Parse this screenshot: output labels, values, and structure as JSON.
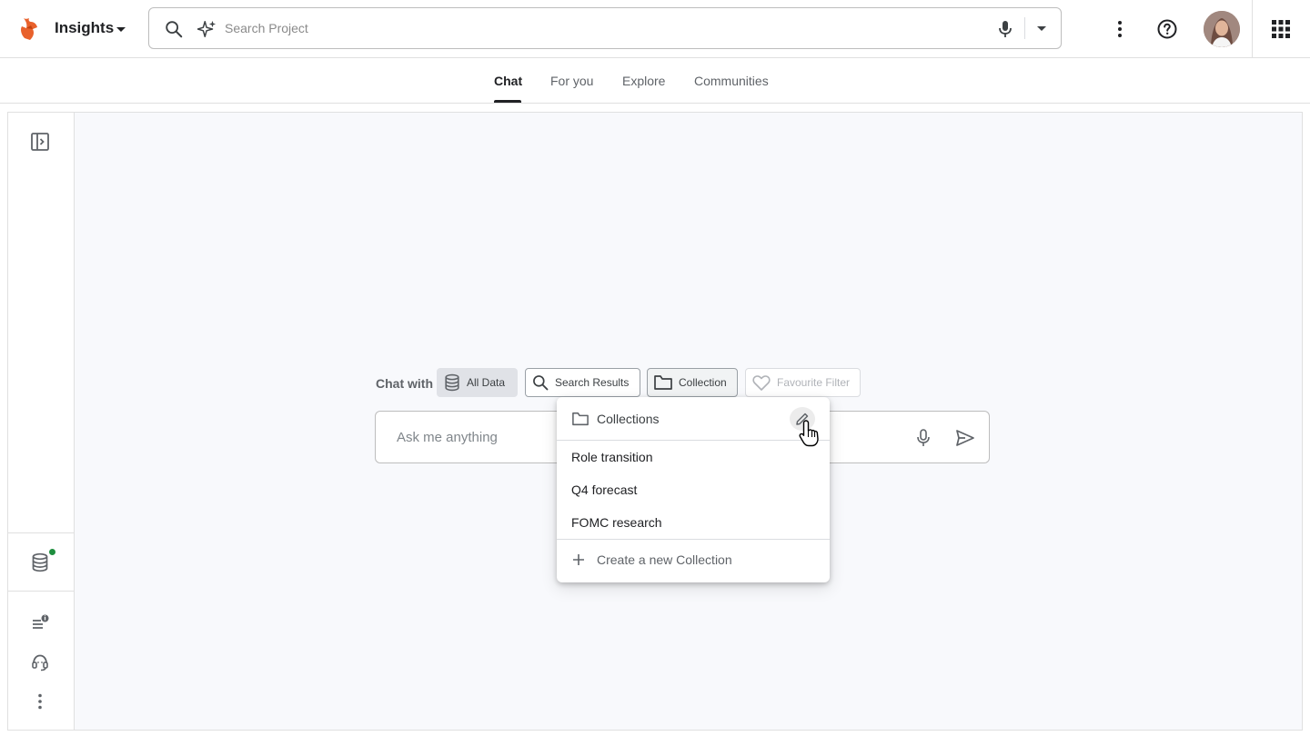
{
  "header": {
    "app_name": "Insights",
    "search_placeholder": "Search Project",
    "icons": [
      "app-logo",
      "caret-down-icon",
      "search-icon",
      "sparkle-icon",
      "mic-icon",
      "dropdown-icon",
      "more-vert-icon",
      "help-icon",
      "avatar",
      "apps-grid-icon"
    ]
  },
  "tabs": [
    {
      "label": "Chat",
      "active": true
    },
    {
      "label": "For you",
      "active": false
    },
    {
      "label": "Explore",
      "active": false
    },
    {
      "label": "Communities",
      "active": false
    }
  ],
  "chat": {
    "chat_with_label": "Chat with",
    "chips": {
      "all_data": "All Data",
      "search_results": "Search Results",
      "collection": "Collection",
      "favourite_filter": "Favourite Filter"
    },
    "ask_placeholder": "Ask me anything"
  },
  "collections_menu": {
    "title": "Collections",
    "items": [
      "Role transition",
      "Q4 forecast",
      "FOMC research"
    ],
    "create_label": "Create a new Collection"
  },
  "colors": {
    "brand_orange": "#e8612c",
    "status_green": "#1e8e3e",
    "panel_bg": "#f8f9fc"
  }
}
